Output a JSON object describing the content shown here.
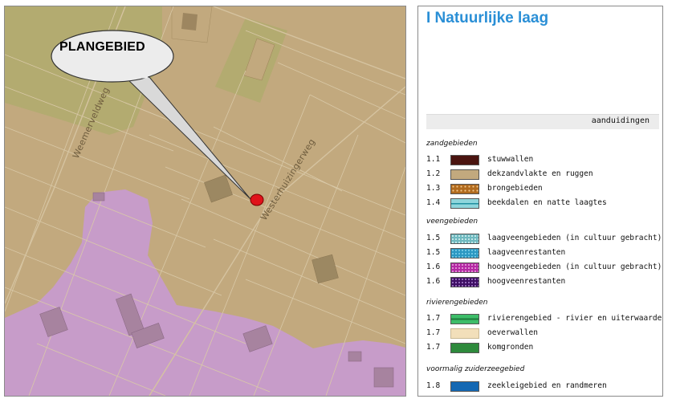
{
  "map": {
    "callout_label": "PLANGEBIED",
    "roads": [
      "Weemerveldweg",
      "Westerhuizingerweg"
    ],
    "colors": {
      "sand": "#c2a97e",
      "peat_purple": "#c79cc9",
      "olive_field": "#b3ab70",
      "grid_line": "#d9c9a8",
      "marker": "#e0121a"
    }
  },
  "legend": {
    "title": "I Natuurlijke laag",
    "header": "aanduidingen",
    "sections": [
      {
        "title": "zandgebieden",
        "items": [
          {
            "code": "1.1",
            "label": "stuwwallen",
            "color": "#4a1410"
          },
          {
            "code": "1.2",
            "label": "dekzandvlakte en ruggen",
            "color": "#c2a97e"
          },
          {
            "code": "1.3",
            "label": "brongebieden",
            "color": "#b06a1e"
          },
          {
            "code": "1.4",
            "label": "beekdalen en natte laagtes",
            "color": "#8ed6dc"
          }
        ]
      },
      {
        "title": "veengebieden",
        "items": [
          {
            "code": "1.5",
            "label": "laagveengebieden (in cultuur gebracht)",
            "color": "#6fb9bf"
          },
          {
            "code": "1.5",
            "label": "laagveenrestanten",
            "color": "#2b98c2"
          },
          {
            "code": "1.6",
            "label": "hoogveengebieden (in cultuur gebracht)",
            "color": "#b52aa4"
          },
          {
            "code": "1.6",
            "label": "hoogveenrestanten",
            "color": "#3e0f63"
          }
        ]
      },
      {
        "title": "rivierengebieden",
        "items": [
          {
            "code": "1.7",
            "label": "rivierengebied - rivier en uiterwaarden",
            "color": "#3dbd69"
          },
          {
            "code": "1.7",
            "label": "oeverwallen",
            "color": "#f2dfba"
          },
          {
            "code": "1.7",
            "label": "komgronden",
            "color": "#2e8a3c"
          }
        ]
      },
      {
        "title": "voormalig zuiderzeegebied",
        "items": [
          {
            "code": "1.8",
            "label": "zeekleigebied en randmeren",
            "color": "#1468b3"
          }
        ]
      }
    ]
  }
}
